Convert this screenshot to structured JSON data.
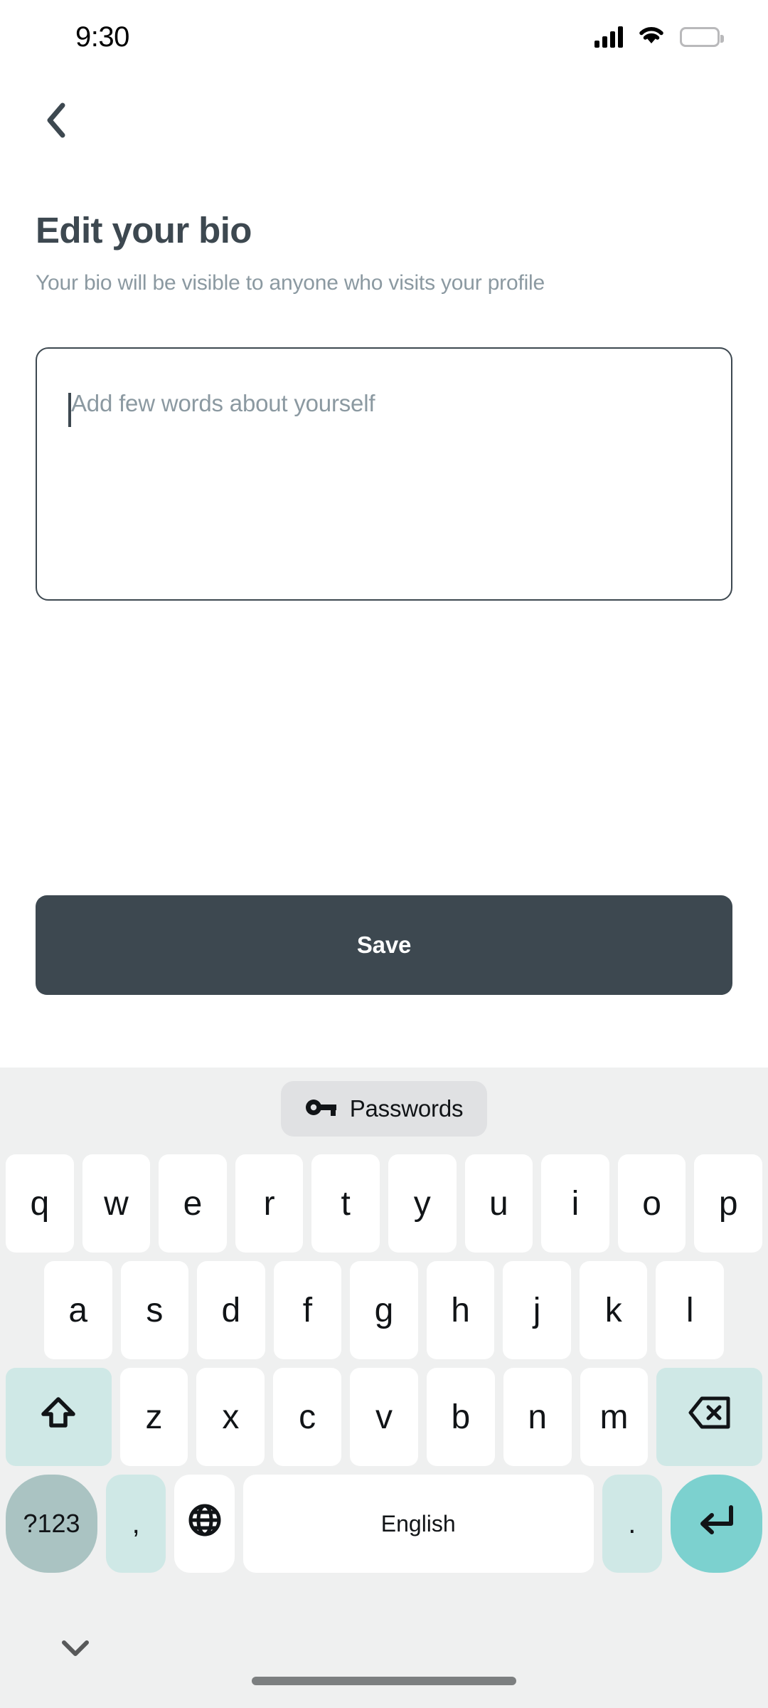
{
  "status_bar": {
    "time": "9:30",
    "signal_icon": "cellular-signal-icon",
    "wifi_icon": "wifi-icon",
    "battery_icon": "battery-full-icon"
  },
  "nav": {
    "back_icon": "chevron-left-icon"
  },
  "page": {
    "title": "Edit your bio",
    "subtitle": "Your bio will be visible to anyone who visits your profile"
  },
  "bio_input": {
    "value": "",
    "placeholder": "Add few words about yourself"
  },
  "actions": {
    "save_label": "Save"
  },
  "keyboard": {
    "suggestion": {
      "label": "Passwords",
      "icon": "key-icon"
    },
    "row1": [
      "q",
      "w",
      "e",
      "r",
      "t",
      "y",
      "u",
      "i",
      "o",
      "p"
    ],
    "row2": [
      "a",
      "s",
      "d",
      "f",
      "g",
      "h",
      "j",
      "k",
      "l"
    ],
    "row3": [
      "z",
      "x",
      "c",
      "v",
      "b",
      "n",
      "m"
    ],
    "shift_icon": "shift-arrow-up-icon",
    "backspace_icon": "backspace-delete-icon",
    "symbols_label": "?123",
    "comma_label": ",",
    "globe_icon": "globe-language-icon",
    "space_label": "English",
    "period_label": ".",
    "enter_icon": "enter-return-icon",
    "hide_keyboard_icon": "chevron-down-icon"
  },
  "colors": {
    "accent_dark": "#3d4850",
    "muted_text": "#8b99a1",
    "keyboard_bg": "#eff0f0",
    "key_mint": "#cfe8e6",
    "key_teal": "#7cd1cf",
    "key_gray_teal": "#aac3c2"
  }
}
